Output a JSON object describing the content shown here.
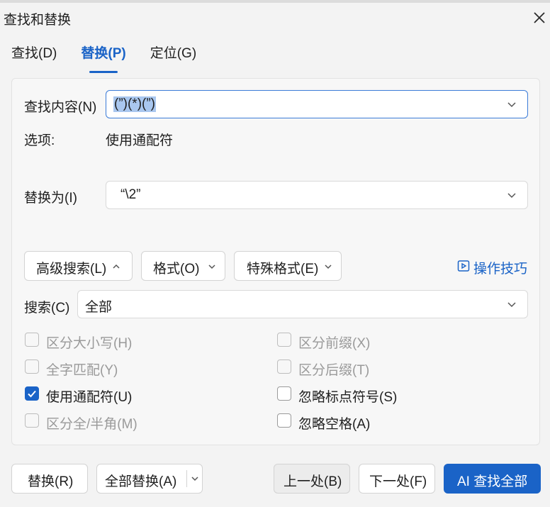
{
  "window": {
    "title": "查找和替换",
    "close_icon": "close-icon"
  },
  "tabs": [
    {
      "label": "查找(D)",
      "active": false
    },
    {
      "label": "替换(P)",
      "active": true
    },
    {
      "label": "定位(G)",
      "active": false
    }
  ],
  "find": {
    "label": "查找内容(N)",
    "value": "(”)(*)(”)",
    "selected": true
  },
  "options": {
    "label": "选项:",
    "value": "使用通配符"
  },
  "replace": {
    "label": "替换为(I)",
    "value": "“\\2”"
  },
  "toolbar": {
    "advanced_search": "高级搜索(L)",
    "format": "格式(O)",
    "special_format": "特殊格式(E)",
    "tips_link": "操作技巧",
    "tips_icon": "play-icon"
  },
  "search": {
    "label": "搜索(C)",
    "value": "全部"
  },
  "checkboxes": {
    "match_case": {
      "label": "区分大小写(H)",
      "checked": false,
      "disabled": true
    },
    "whole_word": {
      "label": "全字匹配(Y)",
      "checked": false,
      "disabled": true
    },
    "wildcards": {
      "label": "使用通配符(U)",
      "checked": true,
      "disabled": false
    },
    "full_half": {
      "label": "区分全/半角(M)",
      "checked": false,
      "disabled": true
    },
    "prefix": {
      "label": "区分前缀(X)",
      "checked": false,
      "disabled": true
    },
    "suffix": {
      "label": "区分后缀(T)",
      "checked": false,
      "disabled": true
    },
    "ignore_punct": {
      "label": "忽略标点符号(S)",
      "checked": false,
      "disabled": false
    },
    "ignore_space": {
      "label": "忽略空格(A)",
      "checked": false,
      "disabled": false
    }
  },
  "actions": {
    "replace": "替换(R)",
    "replace_all": "全部替换(A)",
    "prev": "上一处(B)",
    "next": "下一处(F)",
    "ai_find_all": "AI 查找全部"
  },
  "colors": {
    "accent": "#1a63c7",
    "selection": "#a9c7ef"
  }
}
